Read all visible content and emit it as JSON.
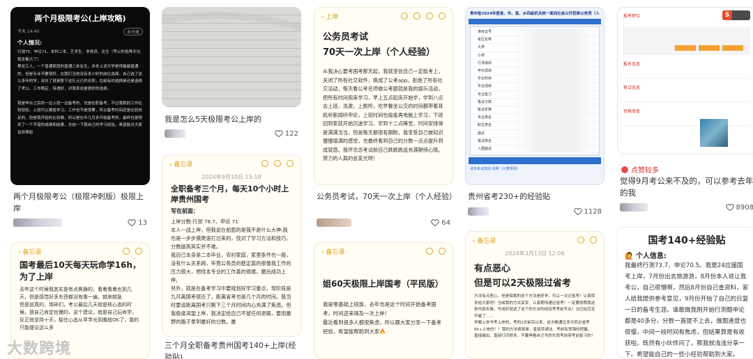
{
  "cards": {
    "c1": {
      "caption": "两个月极限考公（极限冲刺版）极限上岸",
      "likes": "13",
      "thumb_title": "两个月极限考公(上岸攻略)",
      "thumb_time": "今天 14:40",
      "thumb_tag": "未分类",
      "thumb_heading": "个人情况:",
      "thumb_body": "行测75、申论71、本科二本、艺术生、非党员、女生（考公的各种天坑我全都占了）\n黑龙江人，一个普通家庭的普通二本女生，本本上双大学是得最最普通的，但是专业不要很好，在我们当地没有多少好的岗位选择，自己选了这么多年的学，说白了就是那下这扎元已的长职，在结有的选择是还是选择了考公，工作稳定，待遇好，对我来说是更好的选择。\n\n我是毕业之后的一边上班一边备考的，也是在职备考，不过我我的工作比较轻松，上班可以摸鱼学习，工作也不是很累，所以备考时间还是比较充足的，但是我开始的比较晚，所以是在年几月多开始备考的，最终也是得到了一个不错的成绩和结果，总结一下我自己的学习经验，希望能对大家有所帮助"
    },
    "c2": {
      "caption": "我是怎么5天极限考公上岸的",
      "likes": "122"
    },
    "c3": {
      "caption": "三个月全职备考贵州国考140+上岸(经验贴)",
      "likes": "",
      "back_label": "备忘录",
      "date": "2024年9月10日 15:18",
      "title": "全职备考三个月，每天10个小时上岸贵州国考",
      "subhead": "写在前面：",
      "body": "上岸分数:行测 78.7、申论 71\n本人一战上岸，但我说在前面的是我不是什么大神;我也是一步步摸爬滚打过来的，找对了学习方法和技巧，分数提高其实并不难。\n我自己本身是二本毕业，农村家庭，家里条件也一般，没有什么关系网，毕竟公务员的稳定真的很像我工作的压力很大，想找本专业的工作真的很难。最后成功上岸。\n另外，就是在备考学习中要规划好学习重点，现阶段是九月离国考很近了，距离省考也是几个月的时间。我当时要说距离国考只剩下三个月时间内心充满了焦虑。但我极度渴望上岸，我决定给自己不留任何退路，要用最野的路子拿到最好的分数。最"
    },
    "c4": {
      "caption": "公务员考试，70天一次上岸（个人经验）",
      "likes": "64",
      "back_label": "上岸",
      "title": "公务员考试\n70天一次上岸（个人经验）",
      "body": "从我决心要考国考那天起，我就坚信自己一定能考上，关闭了所有社交软件，换成了公考app。拒绝了所有社交活动，每天看公考名师做公考题就是我的娱乐活动，把所有时间用来学习，早上五点起床开始学，学到八点去上班，洗漱，上厕所，吃早餐坐公交的时间都带着耳机听新闻听申论，上班时间也偷偷再电脑上学习，下班回到家就开始沉迷学习，学到十二点睡觉，时间安排得是满满当当，但是每天都很有期盼，我享受自己被知识慢慢填满的感觉，也最终看到自己的分数一点点提升到成就感。我坏念念考试前自己跌跌跌追充满期待心情。努力的人真的会发光呀！"
    },
    "c5": {
      "caption": "姐60天极限上岸国考（平民版）",
      "back_label": "备忘录",
      "title": "姐60天极限上岸国考（平民版）",
      "body": "我是零基础上班族，去年也是这个时间开始备考国考，时间还来得及一次上岸！\n最近看到很多人都很焦虑，所以跟大家分享一下备考经验，希望能帮助到大家🔥"
    },
    "c6": {
      "caption": "贵州省考230+的经验贴",
      "likes": "1128",
      "doc_title": "贵州省2024年度省、市、县、乡四级机关统一面向社会公开招录公务员（人",
      "rows": [
        "准考证号",
        "考区名称",
        "大类",
        "小类",
        "行测成绩",
        "申论成绩",
        "专业科目",
        "专业成绩",
        "专业能力",
        "笔试分数",
        "笔试折算",
        "专业排名",
        "职位排名",
        "面试",
        "笔试排名",
        "入围面试"
      ],
      "footer": "请本考试成绩  说明（计算规则）"
    },
    "c7": {
      "caption": "有点恶心 但是可以2天极限过省考",
      "back_label": "备忘录",
      "date": "2024年3月13日 12:08",
      "title": "有点恶心\n但是可以2天极限过省考",
      "body": "方法有点恶心，但是探索的这个方法是好学，可以一次过省考！认真转发给大家吧！当成我的方式享受、认真期待通过省考！一定要按照我这条内容去做，写成好就选了这个的方法的经验考考前写出！当已经完全不敢了……\n学解上岸书考上岸的，考的2次前后以来，这次都通过多次而且省考85+上岸的！！我的方法很简单，直接背诵法、考前有很强的把握，直接输出，直接打印很多，不要再看自己写的东西考前带考前复习的！"
    },
    "c8": {
      "caption": "觉得9月考公来不及的，可以参考去年的我",
      "likes": "8908",
      "badge": "点赞较多",
      "label_top": "报考职位",
      "fields": [
        "报名信息",
        "笔试信息",
        "资格审查"
      ]
    },
    "c9": {
      "caption": "",
      "title": "国考140+经验贴",
      "heading": "个人信息:",
      "body": "我最终行测73.7、申论70.5。我是24应届国考上岸，7月份出去旅游游，8月份本人说让我考公，自己很懵啊，然后8月份自己查资料，家人给我提供参考意见，9月份开始了自己的日复一日的备考生涯。谁敢做我刚开始行测题申论都是40多分，分数一直提不上去，做题速度也很慢，中间一段时间有焦虑，但结果算是有收获啦。既然有小伙伴问了，那我就浅浅分享一下。希望能自己的一些小经验帮助到大家。"
    },
    "c10": {
      "caption": "",
      "back_label": "备忘录",
      "title": "国考最后10天每天玩命学16h，为了上岸",
      "body": "去年这个时候我其实是有点焦躁的，看着看着也到几天，但是感觉好多东西都没有看一遍，越来越急\n但是说真的，琐碎们，考公最后几天就是核心态的时候，我自己肯定也慢的，这个建议，就是自己玩命学，反正就坚持十天，稳住心态从早学光到晚就OK了，我的只能提议这么多"
    }
  },
  "watermark": "大数跨境",
  "colors": {
    "memo_accent": "#e2a020",
    "red_badge": "#d0312d"
  }
}
